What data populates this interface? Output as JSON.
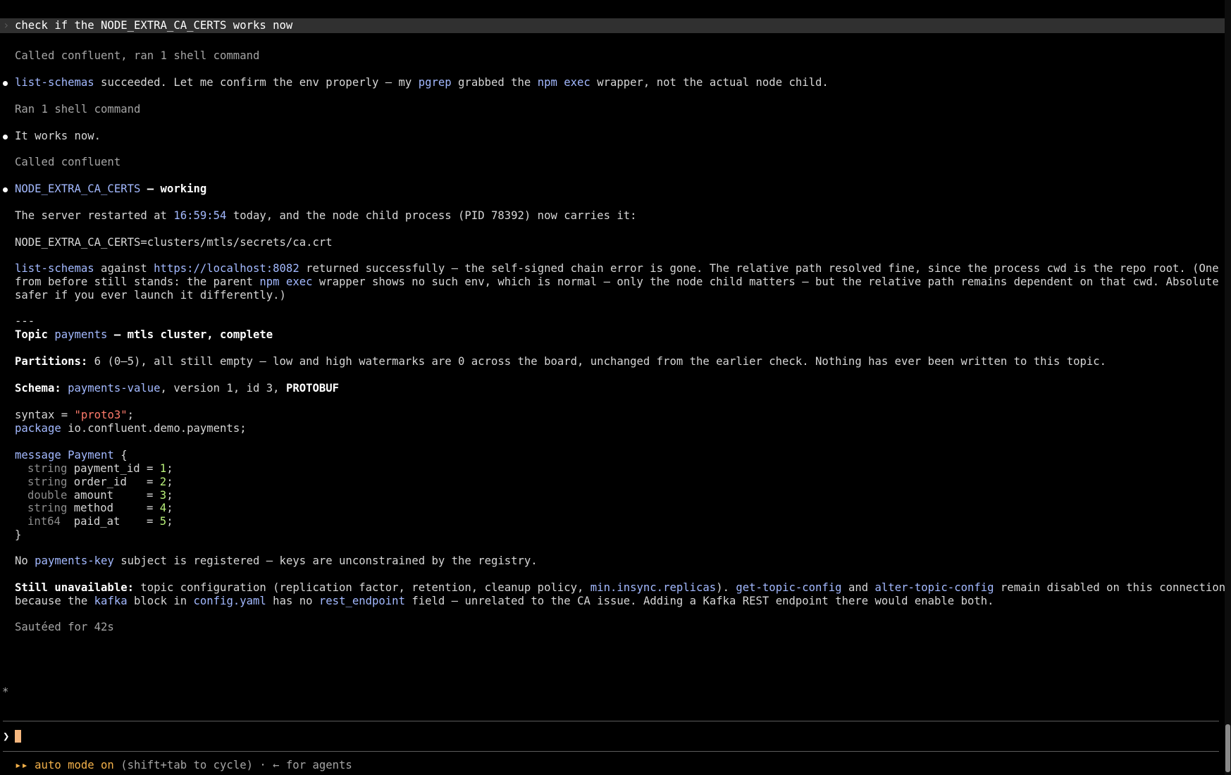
{
  "user_prompt": "check if the NODE_EXTRA_CA_CERTS works now",
  "tool1": "Called confluent, ran 1 shell command",
  "msg1": {
    "a": "list-schemas",
    "b": " succeeded. Let me confirm the env properly — my ",
    "c": "pgrep",
    "d": " grabbed the ",
    "e": "npm exec",
    "f": " wrapper, not the actual node child."
  },
  "tool2": "Ran 1 shell command",
  "msg2": "It works now.",
  "tool3": "Called confluent",
  "heading1": {
    "a": "NODE_EXTRA_CA_CERTS",
    "b": " — working"
  },
  "para1": {
    "a": "The server restarted at ",
    "b": "16:59:54",
    "c": " today, and the node child process (PID 78392) now carries it:"
  },
  "env_line": "NODE_EXTRA_CA_CERTS=clusters/mtls/secrets/ca.crt",
  "para2": {
    "a": "list-schemas",
    "b": " against ",
    "c": "https://localhost:8082",
    "d": " returned successfully — the self-signed chain error is gone. The relative path resolved fine, since the process cwd is the repo root. (One caveat",
    "e": "from before still stands: the parent ",
    "f": "npm exec",
    "g": " wrapper shows no such env, which is normal — only the node child matters — but the relative path remains dependent on that cwd. Absolute is",
    "h": "safer if you ever launch it differently.)"
  },
  "divider": "---",
  "heading2": {
    "a": "Topic ",
    "b": "payments",
    "c": " — mtls cluster, complete"
  },
  "partitions": {
    "label": "Partitions:",
    "text": " 6 (0–5), all still empty — low and high watermarks are 0 across the board, unchanged from the earlier check. Nothing has ever been written to this topic."
  },
  "schema": {
    "label": "Schema:",
    "a": "payments-value",
    "b": ", version 1, id 3, ",
    "c": "PROTOBUF"
  },
  "code": {
    "syntax_kw": "syntax",
    "syntax_eq": " = ",
    "syntax_val": "\"proto3\"",
    "syntax_end": ";",
    "pkg_kw": "package",
    "pkg_name": " io.confluent.demo.payments;",
    "msg_kw": "message",
    "msg_name": " Payment",
    "msg_open": " {",
    "fields": [
      {
        "type": "string",
        "name": " payment_id",
        "eq": " = ",
        "num": "1",
        "end": ";"
      },
      {
        "type": "string",
        "name": " order_id  ",
        "eq": " = ",
        "num": "2",
        "end": ";"
      },
      {
        "type": "double",
        "name": " amount    ",
        "eq": " = ",
        "num": "3",
        "end": ";"
      },
      {
        "type": "string",
        "name": " method    ",
        "eq": " = ",
        "num": "4",
        "end": ";"
      },
      {
        "type": "int64 ",
        "name": " paid_at   ",
        "eq": " = ",
        "num": "5",
        "end": ";"
      }
    ],
    "close": "}"
  },
  "nokey": {
    "a": "No ",
    "b": "payments-key",
    "c": " subject is registered — keys are unconstrained by the registry."
  },
  "still": {
    "label": "Still unavailable:",
    "a": " topic configuration (replication factor, retention, cleanup policy, ",
    "b": "min.insync.replicas",
    "c": "). ",
    "d": "get-topic-config",
    "e": " and ",
    "f": "alter-topic-config",
    "g": " remain disabled on this connection",
    "h": "because the ",
    "i": "kafka",
    "j": " block in ",
    "k": "config.yaml",
    "l": " has no ",
    "m": "rest_endpoint",
    "n": " field — unrelated to the CA issue. Adding a Kafka REST endpoint there would enable both."
  },
  "status": {
    "glyph": "*",
    "text": "Sautéed for 42s"
  },
  "input": {
    "chevron": "❯",
    "value": ""
  },
  "footer": {
    "mode": "▸▸ auto mode on",
    "hint": " (shift+tab to cycle) · ← for agents"
  },
  "colors": {
    "accent": "#a3b9ff",
    "string": "#ff7b6b",
    "number": "#b8f07a",
    "mode": "#f4b14a",
    "cursor": "#f4b67e"
  }
}
